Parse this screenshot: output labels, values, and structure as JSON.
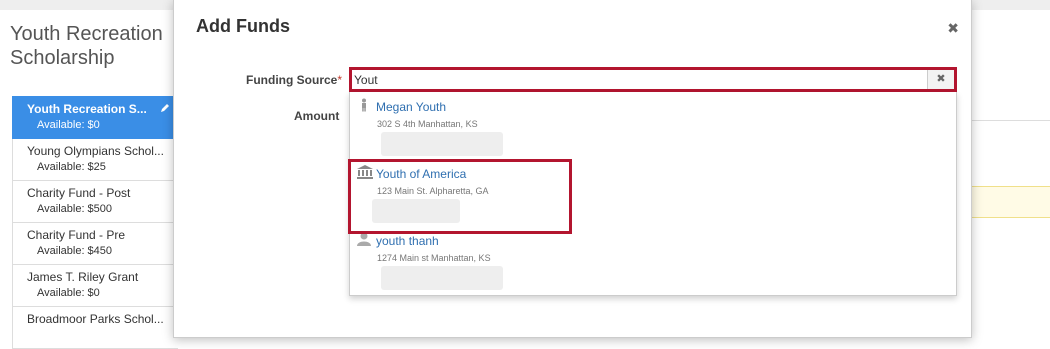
{
  "page": {
    "title": "Youth Recreation Scholarship"
  },
  "funds": [
    {
      "name": "Youth Recreation S...",
      "available": "Available: $0",
      "active": true
    },
    {
      "name": "Young Olympians Schol...",
      "available": "Available: $25"
    },
    {
      "name": "Charity Fund - Post",
      "available": "Available: $500"
    },
    {
      "name": "Charity Fund - Pre",
      "available": "Available: $450"
    },
    {
      "name": "James T. Riley Grant",
      "available": "Available: $0"
    },
    {
      "name": "Broadmoor Parks Schol...",
      "available": ""
    }
  ],
  "modal": {
    "title": "Add Funds",
    "close_glyph": "✖",
    "funding_source_label": "Funding Source",
    "required_marker": "*",
    "amount_label": "Amount",
    "search_value": "Yout",
    "clear_glyph": "✖"
  },
  "results": [
    {
      "name": "Megan Youth",
      "address": "302 S 4th Manhattan, KS",
      "icon": "person-standing-icon"
    },
    {
      "name": "Youth of America",
      "address": "123 Main St. Alpharetta, GA",
      "icon": "institution-icon"
    },
    {
      "name": "youth thanh",
      "address": "1274 Main st Manhattan, KS",
      "icon": "user-silhouette-icon"
    }
  ],
  "colors": {
    "accent": "#3a8ee6",
    "highlight": "#b3152f",
    "link": "#2f6fb0"
  }
}
